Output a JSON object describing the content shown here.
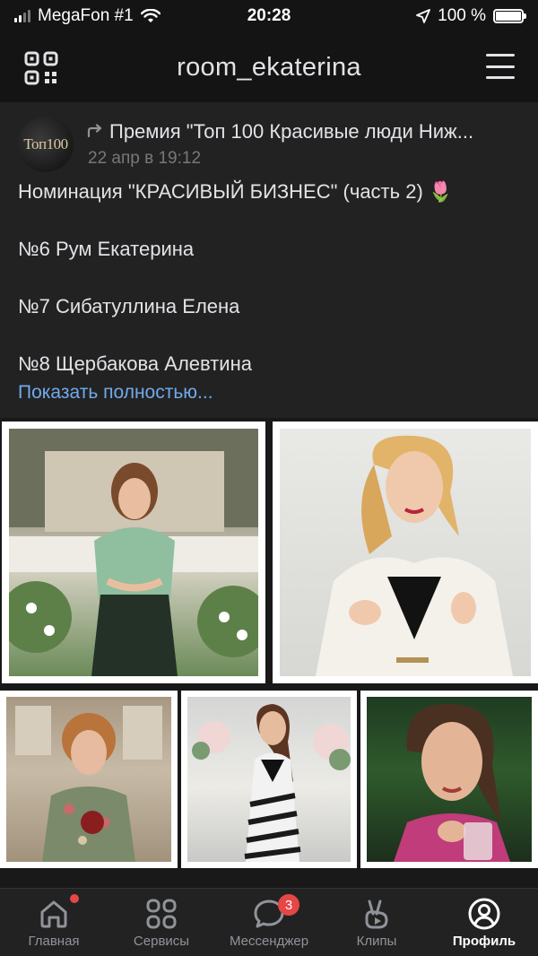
{
  "status_bar": {
    "carrier": "MegaFon #1",
    "time": "20:28",
    "battery": "100 %"
  },
  "header": {
    "title": "room_ekaterina",
    "left_icon": "qr-code-icon",
    "right_icon": "menu-icon"
  },
  "post": {
    "avatar_text": "Топ100",
    "author": "Премия \"Топ 100 Красивые люди Ниж...",
    "date": "22 апр в 19:12",
    "lines": [
      "Номинация \"КРАСИВЫЙ БИЗНЕС\" (часть 2) 🌷",
      "№6 Рум Екатерина",
      "№7 Сибатуллина Елена",
      "№8 Щербакова Алевтина"
    ],
    "show_more": "Показать полностью..."
  },
  "tabbar": {
    "items": [
      {
        "label": "Главная",
        "icon": "home-icon"
      },
      {
        "label": "Сервисы",
        "icon": "services-icon"
      },
      {
        "label": "Мессенджер",
        "icon": "messenger-icon",
        "badge": "3"
      },
      {
        "label": "Клипы",
        "icon": "clips-icon"
      },
      {
        "label": "Профиль",
        "icon": "profile-icon"
      }
    ]
  },
  "colors": {
    "background": "#19191a",
    "card": "#222223",
    "link": "#71aaeb",
    "badge": "#e64646"
  }
}
